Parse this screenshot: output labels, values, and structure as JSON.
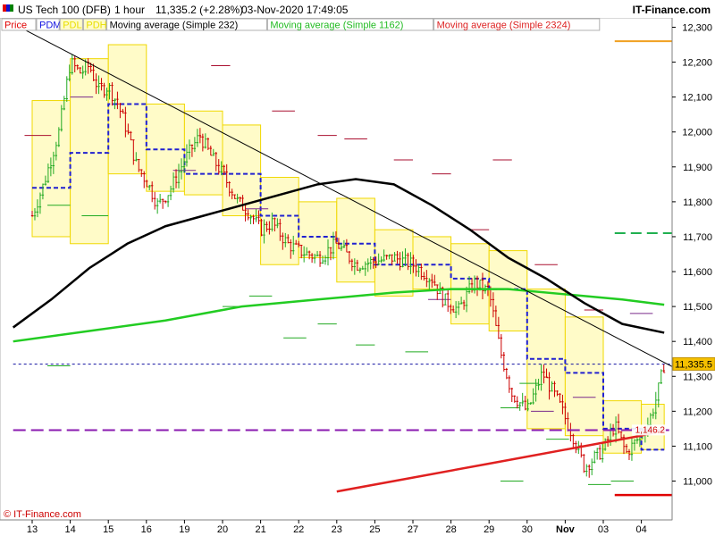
{
  "header": {
    "instrument": "US Tech 100 (DFB)",
    "timeframe": "1 hour",
    "quote": "11,335.2 (+2.28%)",
    "datetime": "03-Nov-2020 17:49:05",
    "brand": "IT-Finance.com"
  },
  "legend": [
    {
      "label": "Price",
      "color": "#e00000"
    },
    {
      "label": "PDM",
      "color": "#1010e0"
    },
    {
      "label": "PDL",
      "color": "#e8e000"
    },
    {
      "label": "PDH",
      "color": "#e8e000"
    },
    {
      "label": "Moving average (Simple 232)",
      "color": "#000000"
    },
    {
      "label": "Moving average (Simple 1162)",
      "color": "#22bb22"
    },
    {
      "label": "Moving average (Simple 2324)",
      "color": "#dd2222"
    }
  ],
  "footer": {
    "copyright": "© IT-Finance.com"
  },
  "colors": {
    "up_candle": "#22aa22",
    "down_candle": "#cc0000",
    "ma232": "#000000",
    "ma1162": "#22cc22",
    "ma2324": "#e02020",
    "box_fill": "#fffbc8",
    "box_stroke": "#f0d800",
    "pdm": "#2020d0",
    "orange": "#f0a020",
    "purple": "#8a1ab0",
    "green_dash": "#20b050",
    "bottom_red": "#e00000"
  },
  "chart_data": {
    "type": "candlestick",
    "ylim": [
      10940,
      12300
    ],
    "y_ticks": [
      11000,
      11100,
      11200,
      11300,
      11400,
      11500,
      11600,
      11700,
      11800,
      11900,
      12000,
      12100,
      12200,
      12300
    ],
    "y_tick_labels": [
      "11,000",
      "11,100",
      "11,200",
      "11,300",
      "11,400",
      "11,500",
      "11,600",
      "11,700",
      "11,800",
      "11,900",
      "12,000",
      "12,100",
      "12,200",
      "12,300"
    ],
    "x_labels": [
      "13",
      "14",
      "15",
      "16",
      "19",
      "20",
      "21",
      "22",
      "23",
      "25",
      "27",
      "28",
      "29",
      "30",
      "Nov",
      "03",
      "04"
    ],
    "last_price": 11335.5,
    "last_price_label": "11,335.5",
    "ma2324_value": 11146.2,
    "ma2324_label": "1,146.2",
    "close_path": [
      [
        0,
        11760
      ],
      [
        0.3,
        11850
      ],
      [
        0.7,
        12000
      ],
      [
        1.0,
        12200
      ],
      [
        1.25,
        12170
      ],
      [
        1.5,
        12190
      ],
      [
        1.75,
        12120
      ],
      [
        2.0,
        12130
      ],
      [
        2.25,
        12080
      ],
      [
        2.5,
        12000
      ],
      [
        2.75,
        11900
      ],
      [
        3.0,
        11860
      ],
      [
        3.3,
        11790
      ],
      [
        3.6,
        11830
      ],
      [
        4.0,
        11920
      ],
      [
        4.4,
        11990
      ],
      [
        4.7,
        11930
      ],
      [
        5.0,
        11880
      ],
      [
        5.4,
        11800
      ],
      [
        5.7,
        11770
      ],
      [
        6.0,
        11720
      ],
      [
        6.3,
        11740
      ],
      [
        6.7,
        11680
      ],
      [
        7.0,
        11660
      ],
      [
        7.5,
        11640
      ],
      [
        8.0,
        11680
      ],
      [
        8.5,
        11620
      ],
      [
        9.0,
        11630
      ],
      [
        9.5,
        11640
      ],
      [
        10.0,
        11620
      ],
      [
        10.5,
        11580
      ],
      [
        10.8,
        11520
      ],
      [
        11.2,
        11490
      ],
      [
        11.6,
        11570
      ],
      [
        12.0,
        11540
      ],
      [
        12.3,
        11370
      ],
      [
        12.6,
        11250
      ],
      [
        13.0,
        11200
      ],
      [
        13.4,
        11310
      ],
      [
        13.8,
        11230
      ],
      [
        14.2,
        11130
      ],
      [
        14.5,
        11040
      ],
      [
        15.0,
        11090
      ],
      [
        15.3,
        11160
      ],
      [
        15.6,
        11080
      ],
      [
        15.9,
        11120
      ],
      [
        16.2,
        11170
      ],
      [
        16.4,
        11240
      ],
      [
        16.6,
        11335
      ]
    ],
    "day_boxes": [
      {
        "x0": 0.0,
        "x1": 1.0,
        "low": 11700,
        "high": 12090,
        "pdm": 11840
      },
      {
        "x0": 1.0,
        "x1": 2.0,
        "low": 11680,
        "high": 12210,
        "pdm": 11940
      },
      {
        "x0": 2.0,
        "x1": 3.0,
        "low": 11880,
        "high": 12250,
        "pdm": 12080
      },
      {
        "x0": 3.0,
        "x1": 4.0,
        "low": 11830,
        "high": 12080,
        "pdm": 11950
      },
      {
        "x0": 4.0,
        "x1": 5.0,
        "low": 11820,
        "high": 12060,
        "pdm": 11880
      },
      {
        "x0": 5.0,
        "x1": 6.0,
        "low": 11760,
        "high": 12020,
        "pdm": 11880
      },
      {
        "x0": 6.0,
        "x1": 7.0,
        "low": 11620,
        "high": 11870,
        "pdm": 11760
      },
      {
        "x0": 7.0,
        "x1": 8.0,
        "low": 11640,
        "high": 11800,
        "pdm": 11700
      },
      {
        "x0": 8.0,
        "x1": 9.0,
        "low": 11570,
        "high": 11810,
        "pdm": 11680
      },
      {
        "x0": 9.0,
        "x1": 10.0,
        "low": 11530,
        "high": 11720,
        "pdm": 11620
      },
      {
        "x0": 10.0,
        "x1": 11.0,
        "low": 11550,
        "high": 11700,
        "pdm": 11620
      },
      {
        "x0": 11.0,
        "x1": 12.0,
        "low": 11450,
        "high": 11680,
        "pdm": 11580
      },
      {
        "x0": 12.0,
        "x1": 13.0,
        "low": 11430,
        "high": 11660,
        "pdm": 11550
      },
      {
        "x0": 13.0,
        "x1": 14.0,
        "low": 11150,
        "high": 11550,
        "pdm": 11350
      },
      {
        "x0": 14.0,
        "x1": 15.0,
        "low": 11130,
        "high": 11470,
        "pdm": 11310
      },
      {
        "x0": 15.0,
        "x1": 16.0,
        "low": 11080,
        "high": 11230,
        "pdm": 11150
      }
    ],
    "day_ticks": [
      {
        "x0": -0.2,
        "x1": 0.5,
        "y": 11990,
        "c": "#aa1030"
      },
      {
        "x0": 0.4,
        "x1": 1.0,
        "y": 11790,
        "c": "#22aa22"
      },
      {
        "x0": 0.4,
        "x1": 1.0,
        "y": 11330,
        "c": "#22aa22"
      },
      {
        "x0": 1.0,
        "x1": 1.6,
        "y": 12100,
        "c": "#7a2a8a"
      },
      {
        "x0": 1.3,
        "x1": 2.0,
        "y": 11760,
        "c": "#22aa22"
      },
      {
        "x0": 3.7,
        "x1": 4.3,
        "y": 11890,
        "c": "#7a2a8a"
      },
      {
        "x0": 4.7,
        "x1": 5.2,
        "y": 12190,
        "c": "#aa1030"
      },
      {
        "x0": 5.6,
        "x1": 6.2,
        "y": 11780,
        "c": "#7a2a8a"
      },
      {
        "x0": 6.3,
        "x1": 6.9,
        "y": 12060,
        "c": "#aa1030"
      },
      {
        "x0": 5.7,
        "x1": 6.3,
        "y": 11530,
        "c": "#22aa22"
      },
      {
        "x0": 5.0,
        "x1": 5.6,
        "y": 11500,
        "c": "#22aa22"
      },
      {
        "x0": 7.5,
        "x1": 8.0,
        "y": 11990,
        "c": "#aa1030"
      },
      {
        "x0": 8.2,
        "x1": 8.8,
        "y": 11980,
        "c": "#aa1030"
      },
      {
        "x0": 6.6,
        "x1": 7.2,
        "y": 11410,
        "c": "#22aa22"
      },
      {
        "x0": 7.5,
        "x1": 8.0,
        "y": 11450,
        "c": "#22aa22"
      },
      {
        "x0": 8.5,
        "x1": 9.0,
        "y": 11390,
        "c": "#22aa22"
      },
      {
        "x0": 9.5,
        "x1": 10.0,
        "y": 11920,
        "c": "#aa1030"
      },
      {
        "x0": 10.5,
        "x1": 11.0,
        "y": 11880,
        "c": "#aa1030"
      },
      {
        "x0": 11.5,
        "x1": 12.0,
        "y": 11720,
        "c": "#aa1030"
      },
      {
        "x0": 12.1,
        "x1": 12.6,
        "y": 11920,
        "c": "#aa1030"
      },
      {
        "x0": 13.2,
        "x1": 13.8,
        "y": 11620,
        "c": "#aa1030"
      },
      {
        "x0": 13.1,
        "x1": 13.7,
        "y": 11200,
        "c": "#7a2a8a"
      },
      {
        "x0": 14.2,
        "x1": 14.8,
        "y": 11240,
        "c": "#7a2a8a"
      },
      {
        "x0": 14.5,
        "x1": 15.0,
        "y": 11490,
        "c": "#aa1030"
      },
      {
        "x0": 10.4,
        "x1": 11.0,
        "y": 11520,
        "c": "#7a2a8a"
      },
      {
        "x0": 9.8,
        "x1": 10.4,
        "y": 11370,
        "c": "#22aa22"
      },
      {
        "x0": 12.8,
        "x1": 13.3,
        "y": 11280,
        "c": "#22aa22"
      },
      {
        "x0": 12.3,
        "x1": 12.8,
        "y": 11210,
        "c": "#22aa22"
      },
      {
        "x0": 13.5,
        "x1": 14.1,
        "y": 11120,
        "c": "#22aa22"
      },
      {
        "x0": 15.2,
        "x1": 15.8,
        "y": 11000,
        "c": "#22aa22"
      },
      {
        "x0": 12.3,
        "x1": 12.9,
        "y": 11000,
        "c": "#22aa22"
      },
      {
        "x0": 14.6,
        "x1": 15.2,
        "y": 10990,
        "c": "#22aa22"
      },
      {
        "x0": 15.7,
        "x1": 16.3,
        "y": 11480,
        "c": "#7a2a8a"
      }
    ],
    "ma232": [
      [
        -0.5,
        11440
      ],
      [
        0.5,
        11520
      ],
      [
        1.5,
        11610
      ],
      [
        2.5,
        11680
      ],
      [
        3.5,
        11730
      ],
      [
        4.5,
        11760
      ],
      [
        5.5,
        11790
      ],
      [
        6.5,
        11820
      ],
      [
        7.5,
        11850
      ],
      [
        8.5,
        11865
      ],
      [
        9.5,
        11850
      ],
      [
        10.5,
        11790
      ],
      [
        11.5,
        11720
      ],
      [
        12.5,
        11640
      ],
      [
        13.5,
        11580
      ],
      [
        14.5,
        11510
      ],
      [
        15.5,
        11450
      ],
      [
        16.6,
        11425
      ]
    ],
    "ma1162": [
      [
        -0.5,
        11400
      ],
      [
        1.5,
        11430
      ],
      [
        3.5,
        11460
      ],
      [
        5.5,
        11500
      ],
      [
        7.5,
        11520
      ],
      [
        9.5,
        11540
      ],
      [
        11.0,
        11550
      ],
      [
        12.5,
        11550
      ],
      [
        14.0,
        11535
      ],
      [
        15.5,
        11520
      ],
      [
        16.6,
        11505
      ]
    ],
    "ma2324": [
      [
        8.0,
        10970
      ],
      [
        10.0,
        11010
      ],
      [
        12.0,
        11050
      ],
      [
        14.0,
        11090
      ],
      [
        15.0,
        11110
      ],
      [
        16.0,
        11130
      ],
      [
        16.6,
        11146
      ]
    ],
    "trendline": [
      [
        -0.5,
        12310
      ],
      [
        17.3,
        11300
      ]
    ],
    "level_orange": {
      "x0": 15.3,
      "x1": 17.3,
      "y": 12260
    },
    "level_green_dashed": {
      "x0": 15.3,
      "x1": 17.3,
      "y": 11710
    },
    "level_purple_dashed": {
      "x0": -0.5,
      "x1": 17.3,
      "y": 11146
    },
    "level_red_bottom": {
      "x0": 15.3,
      "x1": 17.3,
      "y": 10960
    },
    "last_price_dotted": {
      "x0": -0.5,
      "x1": 17.3,
      "y": 11335
    },
    "current_box": {
      "x0": 16.0,
      "x1": 16.6,
      "low": 11090,
      "high": 11220,
      "pdm": 11090
    }
  }
}
